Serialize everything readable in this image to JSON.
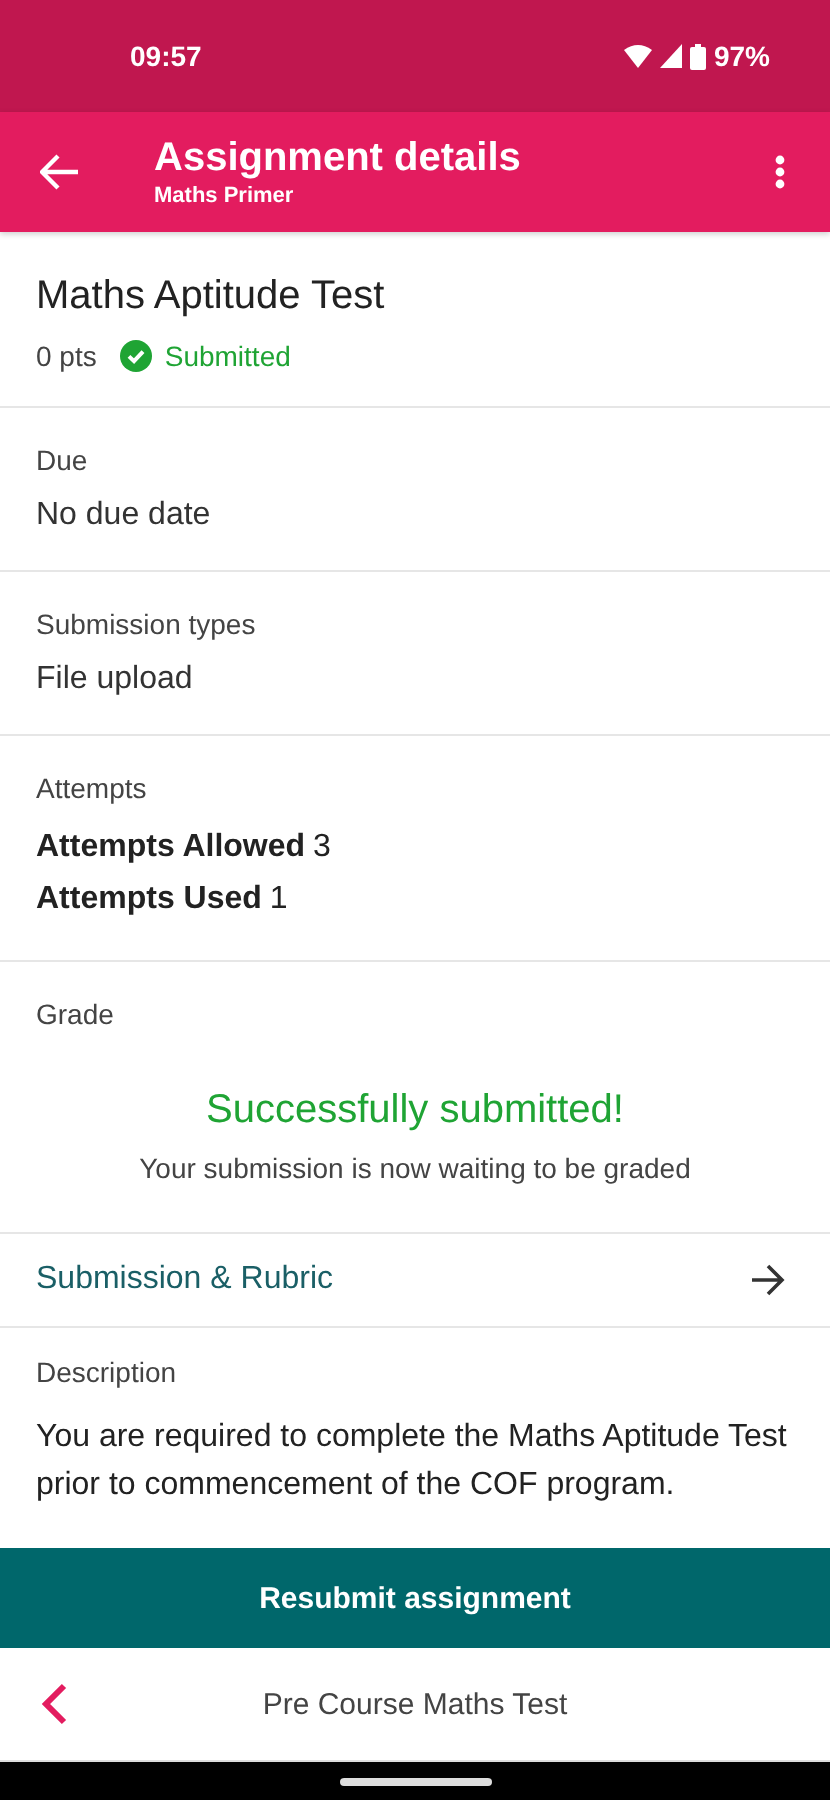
{
  "status_bar": {
    "time": "09:57",
    "battery": "97%"
  },
  "toolbar": {
    "title": "Assignment details",
    "subtitle": "Maths Primer"
  },
  "assignment": {
    "title": "Maths Aptitude Test",
    "points": "0 pts",
    "status": {
      "kind": "submitted",
      "label": "Submitted"
    }
  },
  "sections": [
    {
      "kind": "field",
      "label": "Due",
      "value": "No due date"
    },
    {
      "kind": "field",
      "label": "Submission types",
      "value": "File upload"
    },
    {
      "kind": "attempts",
      "label": "Attempts",
      "rows": [
        {
          "label": "Attempts Allowed",
          "value": "3"
        },
        {
          "label": "Attempts Used",
          "value": "1"
        }
      ]
    },
    {
      "kind": "grade",
      "label": "Grade",
      "message": "Successfully submitted!",
      "detail": "Your submission is now waiting to be graded"
    },
    {
      "kind": "link",
      "label": "Submission & Rubric"
    },
    {
      "kind": "description",
      "label": "Description",
      "text": "You are required to complete the Maths Aptitude Test prior to commencement of the COF program."
    }
  ],
  "action_button": "Resubmit assignment",
  "bottom_nav": {
    "title": "Pre Course Maths Test"
  }
}
